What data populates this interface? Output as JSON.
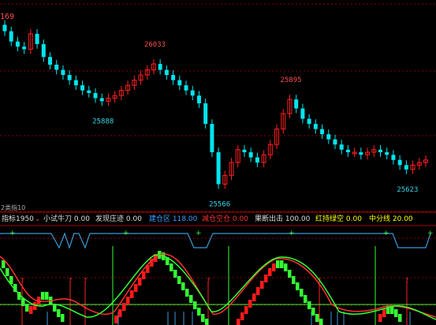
{
  "header": {
    "clipped_label": "169"
  },
  "price_labels": [
    {
      "text": "26033",
      "color": "#ff4d4d"
    },
    {
      "text": "25888",
      "color": "#3ad6e6"
    },
    {
      "text": "25895",
      "color": "#ff4d4d"
    },
    {
      "text": "25566",
      "color": "#3ad6e6"
    },
    {
      "text": "25623",
      "color": "#3ad6e6"
    }
  ],
  "panel_labels": {
    "sub_pane": "2类指10"
  },
  "indicator_bar": [
    {
      "label": "指标1950",
      "color": "#ff4040"
    },
    {
      "label": "小试牛刀",
      "value": "0.00",
      "color": "#ffffff"
    },
    {
      "label": "发现庄迹",
      "value": "0.00",
      "color": "#ffffff"
    },
    {
      "label": "建仓区",
      "value": "118.00",
      "color": "#3aa0ff"
    },
    {
      "label": "减仓空仓",
      "value": "0.00",
      "color": "#ff3030"
    },
    {
      "label": "果断出击",
      "value": "100.00",
      "color": "#ffffff"
    },
    {
      "label": "红持绿空",
      "value": "0.00",
      "color": "#ffff00"
    },
    {
      "label": "中分线",
      "value": "20.00",
      "color": "#ffff00"
    }
  ],
  "colors": {
    "up": "#ff2020",
    "down": "#00e5ee",
    "grid": "#8a0000",
    "ind_up": "#ff1a1a",
    "ind_down": "#33ff33",
    "line_blue": "#3a9ad8"
  },
  "chart_data": {
    "type": "candlestick",
    "close": [
      26160,
      26120,
      26100,
      26090,
      26150,
      26110,
      26060,
      26030,
      26010,
      25990,
      25970,
      25950,
      25930,
      25920,
      25900,
      25888,
      25900,
      25910,
      25930,
      25950,
      25970,
      25990,
      26010,
      26033,
      26010,
      25990,
      25970,
      25950,
      25930,
      25910,
      25880,
      25800,
      25690,
      25566,
      25600,
      25650,
      25700,
      25690,
      25670,
      25650,
      25680,
      25720,
      25780,
      25840,
      25895,
      25860,
      25820,
      25800,
      25780,
      25760,
      25740,
      25720,
      25700,
      25690,
      25690,
      25680,
      25690,
      25700,
      25690,
      25680,
      25660,
      25640,
      25623,
      25640,
      25650,
      25660
    ],
    "labels": [
      {
        "text": "26033",
        "index": 23
      },
      {
        "text": "25888",
        "index": 15
      },
      {
        "text": "25895",
        "index": 44
      },
      {
        "text": "25566",
        "index": 33
      },
      {
        "text": "25623",
        "index": 62
      }
    ]
  }
}
